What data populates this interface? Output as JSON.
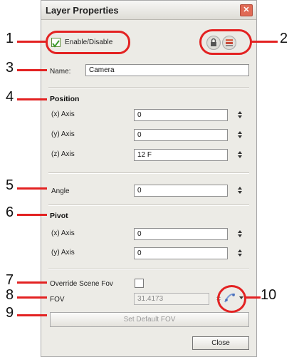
{
  "window": {
    "title": "Layer Properties"
  },
  "enable": {
    "label": "Enable/Disable",
    "checked": true
  },
  "name": {
    "label": "Name:",
    "value": "Camera"
  },
  "position": {
    "header": "Position",
    "x_label": "(x) Axis",
    "x_value": "0",
    "y_label": "(y) Axis",
    "y_value": "0",
    "z_label": "(z) Axis",
    "z_value": "12 F"
  },
  "angle": {
    "label": "Angle",
    "value": "0"
  },
  "pivot": {
    "header": "Pivot",
    "x_label": "(x) Axis",
    "x_value": "0",
    "y_label": "(y) Axis",
    "y_value": "0"
  },
  "override": {
    "label": "Override Scene Fov",
    "checked": false
  },
  "fov": {
    "label": "FOV",
    "value": "31.4173"
  },
  "buttons": {
    "set_default": "Set Default FOV",
    "close": "Close"
  },
  "callouts": [
    "1",
    "2",
    "3",
    "4",
    "5",
    "6",
    "7",
    "8",
    "9",
    "10"
  ],
  "accent": "#e32222",
  "icons": [
    "lock-icon",
    "layer-color-icon",
    "close-icon",
    "function-curve-icon",
    "dropdown-arrow-icon",
    "checkmark-icon",
    "spinner-icon"
  ]
}
